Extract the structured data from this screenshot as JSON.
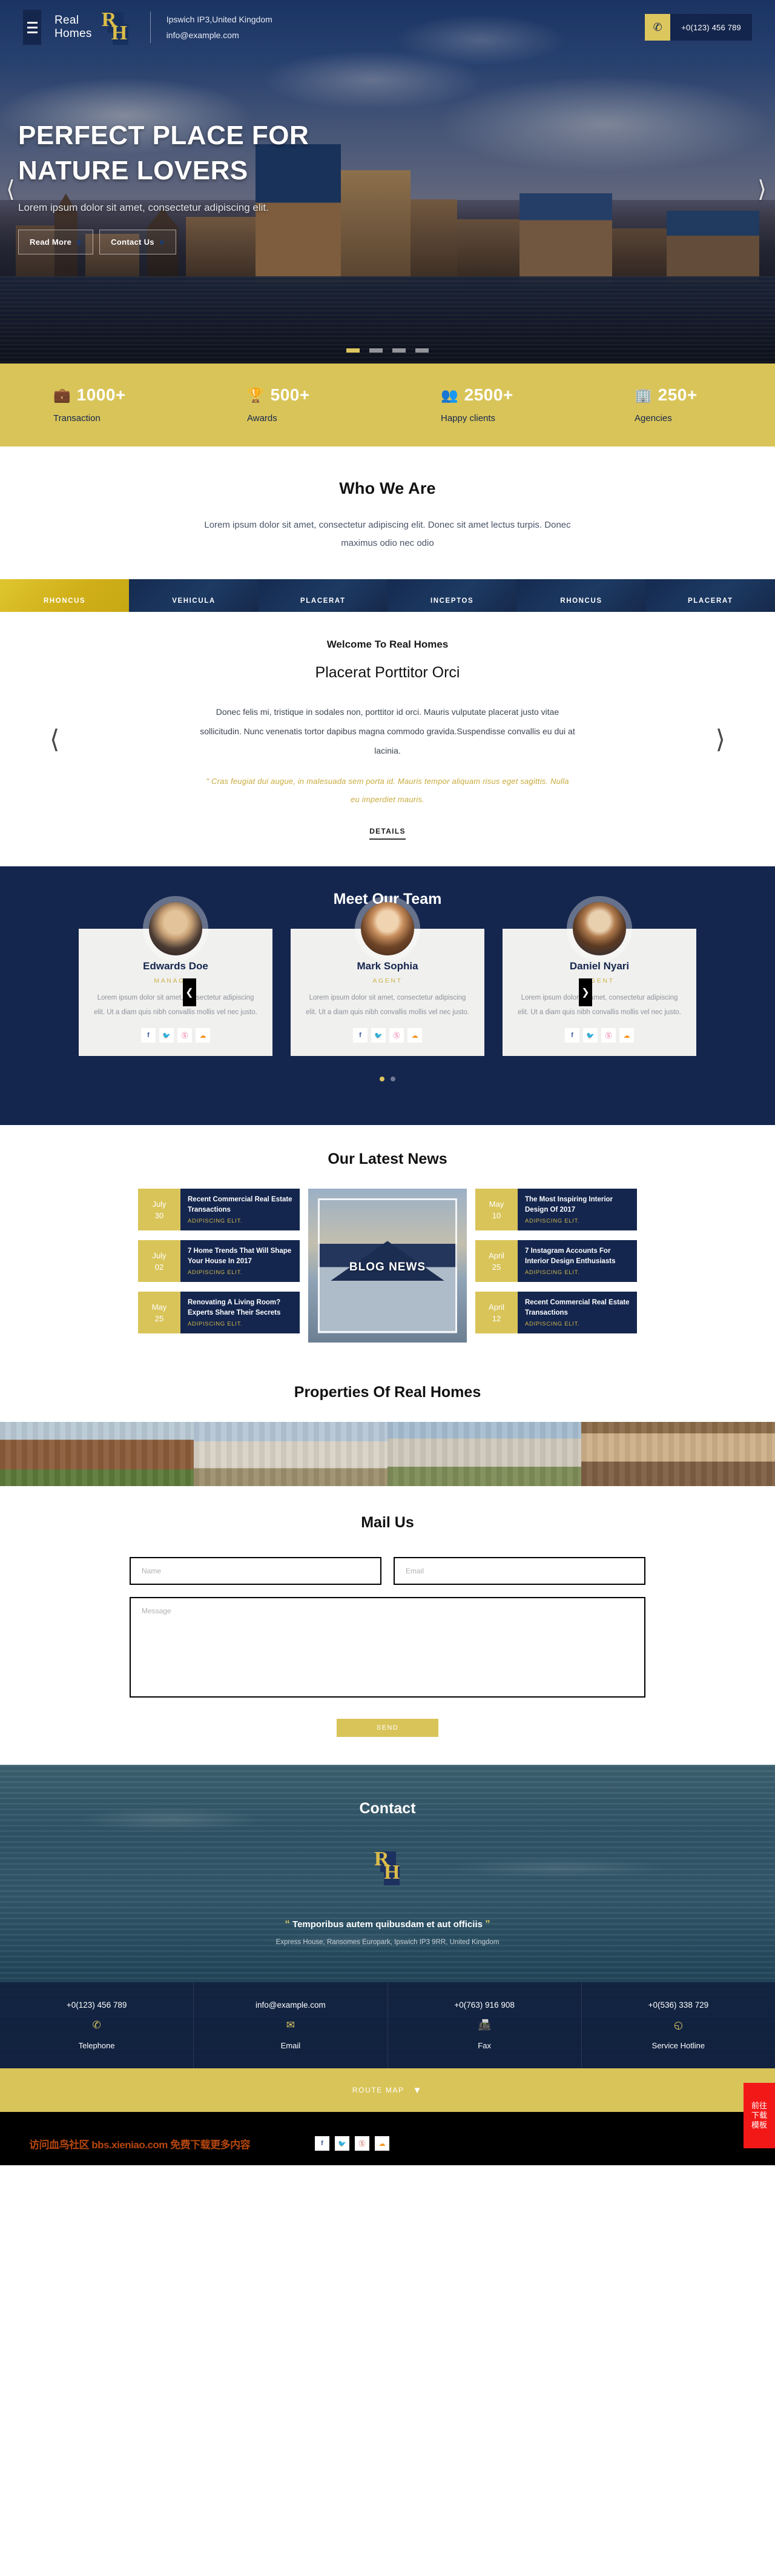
{
  "header": {
    "menu_icon": "hamburger-icon",
    "brand_line1": "Real",
    "brand_line2": "Homes",
    "logo_r": "R",
    "logo_h": "H",
    "address": "Ipswich IP3,United Kingdom",
    "email": "info@example.com",
    "phone_icon": "phone-icon",
    "phone": "+0(123) 456 789"
  },
  "hero": {
    "title": "PERFECT PLACE FOR NATURE LOVERS",
    "subtitle": "Lorem ipsum dolor sit amet, consectetur adipiscing elit.",
    "btn_primary": "Read More",
    "btn_secondary": "Contact Us",
    "prev_icon": "chevron-left-icon",
    "next_icon": "chevron-right-icon"
  },
  "stats": [
    {
      "icon": "briefcase-icon",
      "glyph": "ὋC",
      "number": "1000+",
      "label": "Transaction"
    },
    {
      "icon": "trophy-icon",
      "glyph": "Ἴ6",
      "number": "500+",
      "label": "Awards"
    },
    {
      "icon": "people-icon",
      "glyph": "὆5",
      "number": "2500+",
      "label": "Happy clients"
    },
    {
      "icon": "building-icon",
      "glyph": "Ἶ2",
      "number": "250+",
      "label": "Agencies"
    }
  ],
  "who_we_are": {
    "title": "Who We Are",
    "paragraph": "Lorem ipsum dolor sit amet, consectetur adipiscing elit. Donec sit amet lectus turpis. Donec maximus odio nec odio"
  },
  "tabs": [
    {
      "label": "RHONCUS",
      "active": true
    },
    {
      "label": "VEHICULA",
      "active": false
    },
    {
      "label": "PLACERAT",
      "active": false
    },
    {
      "label": "INCEPTOS",
      "active": false
    },
    {
      "label": "RHONCUS",
      "active": false
    },
    {
      "label": "PLACERAT",
      "active": false
    }
  ],
  "welcome": {
    "kicker": "Welcome To Real Homes",
    "title": "Placerat Porttitor Orci",
    "body": "Donec felis mi, tristique in sodales non, porttitor id orci. Mauris vulputate placerat justo vitae sollicitudin. Nunc venenatis tortor dapibus magna commodo gravida.Suspendisse convallis eu dui at lacinia.",
    "quote": "\" Cras feugiat dui augue, in malesuada sem porta id. Mauris tempor aliquam risus eget sagittis. Nulla eu imperdiet mauris.",
    "details": "DETAILS",
    "prev_icon": "chevron-left-icon",
    "next_icon": "chevron-right-icon"
  },
  "team": {
    "title": "Meet Our Team",
    "prev_icon": "chevron-left-icon",
    "next_icon": "chevron-right-icon",
    "members": [
      {
        "name": "Edwards Doe",
        "role": "MANAGER",
        "desc": "Lorem ipsum dolor sit amet, consectetur adipiscing elit. Ut a diam quis nibh convallis mollis vel nec justo."
      },
      {
        "name": "Mark Sophia",
        "role": "AGENT",
        "desc": "Lorem ipsum dolor sit amet, consectetur adipiscing elit. Ut a diam quis nibh convallis mollis vel nec justo."
      },
      {
        "name": "Daniel Nyari",
        "role": "AGENT",
        "desc": "Lorem ipsum dolor sit amet, consectetur adipiscing elit. Ut a diam quis nibh convallis mollis vel nec justo."
      }
    ],
    "social": [
      "facebook-icon",
      "twitter-icon",
      "dribbble-icon",
      "rss-icon"
    ]
  },
  "news": {
    "title": "Our Latest News",
    "center_caption": "BLOG NEWS",
    "left": [
      {
        "month": "July",
        "day": "30",
        "title": "Recent Commercial Real Estate Transactions",
        "meta": "ADIPISCING ELIT."
      },
      {
        "month": "July",
        "day": "02",
        "title": "7 Home Trends That Will Shape Your House In 2017",
        "meta": "ADIPISCING ELIT."
      },
      {
        "month": "May",
        "day": "25",
        "title": "Renovating A Living Room? Experts Share Their Secrets",
        "meta": "ADIPISCING ELIT."
      }
    ],
    "right": [
      {
        "month": "May",
        "day": "10",
        "title": "The Most Inspiring Interior Design Of 2017",
        "meta": "ADIPISCING ELIT."
      },
      {
        "month": "April",
        "day": "25",
        "title": "7 Instagram Accounts For Interior Design Enthusiasts",
        "meta": "ADIPISCING ELIT."
      },
      {
        "month": "April",
        "day": "12",
        "title": "Recent Commercial Real Estate Transactions",
        "meta": "ADIPISCING ELIT."
      }
    ]
  },
  "properties": {
    "title": "Properties Of Real Homes",
    "items": [
      "property-photo-1",
      "property-photo-2",
      "property-photo-3",
      "property-photo-4"
    ]
  },
  "mail": {
    "title": "Mail Us",
    "name_placeholder": "Name",
    "email_placeholder": "Email",
    "message_placeholder": "Message",
    "send_label": "SEND"
  },
  "contact": {
    "title": "Contact",
    "logo_r": "R",
    "logo_h": "H",
    "quote": "Temporibus autem quibusdam et aut officiis",
    "quote_open": "“",
    "quote_close": "”",
    "address": "Express House, Ransomes Europark, Ipswich IP3 9RR, United Kingdom",
    "cards": [
      {
        "value": "+0(123) 456 789",
        "icon": "phone-icon",
        "glyph": "✆",
        "label": "Telephone"
      },
      {
        "value": "info@example.com",
        "icon": "envelope-icon",
        "glyph": "✉",
        "label": "Email"
      },
      {
        "value": "+0(763) 916 908",
        "icon": "fax-icon",
        "glyph": "὎0",
        "label": "Fax"
      },
      {
        "value": "+0(536) 338 729",
        "icon": "clock-icon",
        "glyph": "◴",
        "label": "Service Hotline"
      }
    ]
  },
  "route_map": {
    "label": "ROUTE MAP",
    "chevron_icon": "chevron-down-icon",
    "chevron": "⌄"
  },
  "bottom": {
    "watermark": "访问血鸟社区 bbs.xieniao.com 免费下载更多内容",
    "social": [
      "facebook-icon",
      "twitter-icon",
      "dribbble-icon",
      "rss-icon"
    ],
    "download_label": "前往下载模板"
  },
  "colors": {
    "gold": "#d9c459",
    "navy": "#14264e",
    "dark_navy": "#11203e"
  }
}
